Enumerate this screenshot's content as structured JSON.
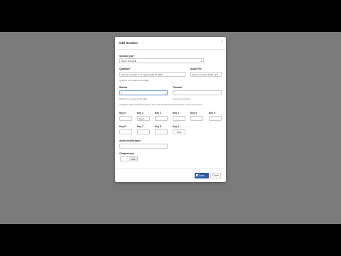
{
  "modal": {
    "title": "Add Section",
    "close_glyph": "×"
  },
  "section_type": {
    "label": "Section type*",
    "value": "MULTI CHOICE"
  },
  "question": {
    "label": "Question*",
    "value": "Press 1 to speak to an agent and 8 for DND",
    "help": "Question to be asked to the caller"
  },
  "audio_file": {
    "label": "Audio File",
    "value": "Press 1 transfer Audio.mp3"
  },
  "retries": {
    "label": "Retries",
    "value": "1",
    "help": "Retries to be asked to the caller"
  },
  "timeout": {
    "label": "Timeout",
    "value": "",
    "help": "Timeout in seconds"
  },
  "keys_help": "Configure valid multi-choice options. The value of each field will be shown in the survey report",
  "keys": [
    {
      "label": "Key 0",
      "value": ""
    },
    {
      "label": "Key 1",
      "value": "Agent"
    },
    {
      "label": "Key 2",
      "value": ""
    },
    {
      "label": "Key 3",
      "value": ""
    },
    {
      "label": "Key 4",
      "value": ""
    },
    {
      "label": "Key 5",
      "value": ""
    },
    {
      "label": "Key 6",
      "value": ""
    },
    {
      "label": "Key 7",
      "value": ""
    },
    {
      "label": "Key 8",
      "value": ""
    },
    {
      "label": "Key 9",
      "value": "DND"
    }
  ],
  "invalid_input": {
    "label": "Audio invalid input",
    "value": "---"
  },
  "compression": {
    "label": "Compression",
    "value": "OFF"
  },
  "footer": {
    "save_label": "Save",
    "close_label": "Close"
  },
  "icons": {
    "select_arrow": "⇕",
    "caret": "⌄"
  },
  "colors": {
    "primary": "#2d5fa6",
    "backdrop": "#7a7a7a",
    "focus": "#7aa7d8"
  }
}
